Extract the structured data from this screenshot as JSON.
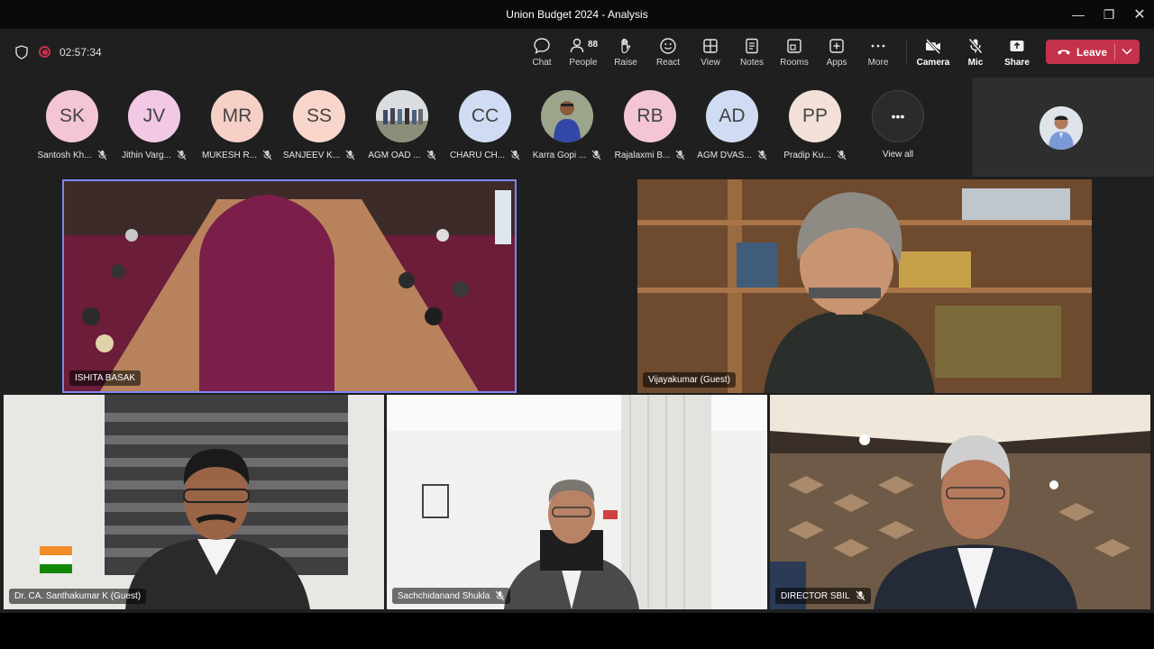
{
  "window": {
    "title": "Union Budget 2024 - Analysis",
    "minimize_glyph": "—",
    "maximize_glyph": "❐",
    "close_glyph": "✕"
  },
  "meeting": {
    "timer": "02:57:34",
    "people_count": "88"
  },
  "toolbar": {
    "chat": "Chat",
    "people": "People",
    "raise": "Raise",
    "react": "React",
    "view": "View",
    "notes": "Notes",
    "rooms": "Rooms",
    "apps": "Apps",
    "more": "More",
    "camera": "Camera",
    "mic": "Mic",
    "share": "Share",
    "leave": "Leave"
  },
  "participants": [
    {
      "initials": "SK",
      "name": "Santosh Kh...",
      "color": "#f4c6d4"
    },
    {
      "initials": "JV",
      "name": "Jithin Varg...",
      "color": "#f1c9e4"
    },
    {
      "initials": "MR",
      "name": "MUKESH R...",
      "color": "#f6d0c7"
    },
    {
      "initials": "SS",
      "name": "SANJEEV K...",
      "color": "#f9d6cb"
    },
    {
      "initials": "",
      "name": "AGM OAD ...",
      "color": "#8e9aa6",
      "photo": true
    },
    {
      "initials": "CC",
      "name": "CHARU CH...",
      "color": "#cfdcf3"
    },
    {
      "initials": "",
      "name": "Karra Gopi ...",
      "color": "#6e7d6a",
      "photo": true
    },
    {
      "initials": "RB",
      "name": "Rajalaxmi B...",
      "color": "#f4c6d4"
    },
    {
      "initials": "AD",
      "name": "AGM DVAS...",
      "color": "#cfdcf3"
    },
    {
      "initials": "PP",
      "name": "Pradip Ku...",
      "color": "#f3e0d8"
    }
  ],
  "view_all": {
    "glyph": "•••",
    "label": "View all"
  },
  "tiles": {
    "conference": {
      "name": "ISHITA BASAK"
    },
    "guest1": {
      "name": "Vijayakumar (Guest)"
    },
    "guest2": {
      "name": "Dr. CA. Santhakumar K (Guest)"
    },
    "guest3": {
      "name": "Sachchidanand Shukla"
    },
    "guest4": {
      "name": "DIRECTOR SBIL"
    }
  },
  "colors": {
    "leave_red": "#c4314b",
    "active_border": "#7f85f5",
    "background": "#1f1f1f"
  }
}
